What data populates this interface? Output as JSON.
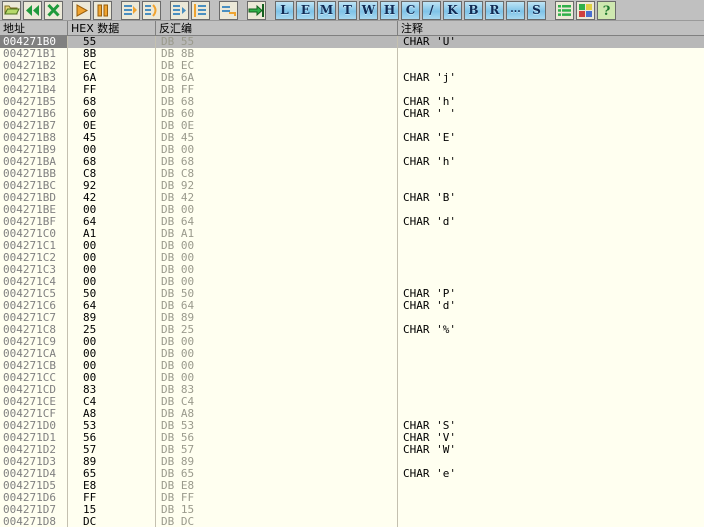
{
  "toolbar": {
    "buttons": [
      {
        "name": "open-file-icon",
        "kind": "icon",
        "icon": "folder"
      },
      {
        "name": "rewind-icon",
        "kind": "icon",
        "icon": "rewind"
      },
      {
        "name": "stop-icon",
        "kind": "icon",
        "icon": "stop-x"
      },
      {
        "name": "separator-1",
        "kind": "sep"
      },
      {
        "name": "run-icon",
        "kind": "icon",
        "icon": "play"
      },
      {
        "name": "pause-icon",
        "kind": "icon",
        "icon": "pause"
      },
      {
        "name": "separator-2",
        "kind": "sep"
      },
      {
        "name": "step-into-icon",
        "kind": "icon",
        "icon": "step-into"
      },
      {
        "name": "step-over-icon",
        "kind": "icon",
        "icon": "step-over"
      },
      {
        "name": "separator-3",
        "kind": "sep"
      },
      {
        "name": "trace-into-icon",
        "kind": "icon",
        "icon": "trace-into"
      },
      {
        "name": "trace-over-icon",
        "kind": "icon",
        "icon": "trace-over"
      },
      {
        "name": "separator-4",
        "kind": "sep"
      },
      {
        "name": "execute-till-return-icon",
        "kind": "icon",
        "icon": "till-return"
      },
      {
        "name": "separator-5",
        "kind": "sep"
      },
      {
        "name": "goto-icon",
        "kind": "icon",
        "icon": "goto-green"
      },
      {
        "name": "separator-6",
        "kind": "sep"
      },
      {
        "name": "log-window-button",
        "kind": "letter",
        "label": "L"
      },
      {
        "name": "executable-modules-button",
        "kind": "letter",
        "label": "E"
      },
      {
        "name": "memory-map-button",
        "kind": "letter",
        "label": "M"
      },
      {
        "name": "threads-button",
        "kind": "letter",
        "label": "T"
      },
      {
        "name": "windows-button",
        "kind": "letter",
        "label": "W"
      },
      {
        "name": "handles-button",
        "kind": "letter",
        "label": "H"
      },
      {
        "name": "cpu-button",
        "kind": "letter",
        "label": "C"
      },
      {
        "name": "patches-button",
        "kind": "letter",
        "label": "/"
      },
      {
        "name": "call-stack-button",
        "kind": "letter",
        "label": "K"
      },
      {
        "name": "breakpoints-button",
        "kind": "letter",
        "label": "B"
      },
      {
        "name": "references-button",
        "kind": "letter",
        "label": "R"
      },
      {
        "name": "run-trace-button",
        "kind": "letter",
        "label": "..."
      },
      {
        "name": "source-button",
        "kind": "letter",
        "label": "S"
      },
      {
        "name": "separator-7",
        "kind": "sep"
      },
      {
        "name": "options-list-icon",
        "kind": "icon",
        "icon": "list-green"
      },
      {
        "name": "appearance-icon",
        "kind": "icon",
        "icon": "palette"
      },
      {
        "name": "help-icon",
        "kind": "icon",
        "icon": "help"
      }
    ]
  },
  "grid": {
    "columns": [
      {
        "key": "address",
        "label": "地址"
      },
      {
        "key": "hex",
        "label": "HEX 数据"
      },
      {
        "key": "disasm",
        "label": "反汇编"
      },
      {
        "key": "comment",
        "label": "注释"
      }
    ],
    "selected_index": 0,
    "rows": [
      {
        "address": "004271B0",
        "hex": "55",
        "disasm": "DB  55",
        "comment": "CHAR 'U'"
      },
      {
        "address": "004271B1",
        "hex": "8B",
        "disasm": "DB  8B",
        "comment": ""
      },
      {
        "address": "004271B2",
        "hex": "EC",
        "disasm": "DB  EC",
        "comment": ""
      },
      {
        "address": "004271B3",
        "hex": "6A",
        "disasm": "DB  6A",
        "comment": "CHAR 'j'"
      },
      {
        "address": "004271B4",
        "hex": "FF",
        "disasm": "DB  FF",
        "comment": ""
      },
      {
        "address": "004271B5",
        "hex": "68",
        "disasm": "DB  68",
        "comment": "CHAR 'h'"
      },
      {
        "address": "004271B6",
        "hex": "60",
        "disasm": "DB  60",
        "comment": "CHAR ' '"
      },
      {
        "address": "004271B7",
        "hex": "0E",
        "disasm": "DB  0E",
        "comment": ""
      },
      {
        "address": "004271B8",
        "hex": "45",
        "disasm": "DB  45",
        "comment": "CHAR 'E'"
      },
      {
        "address": "004271B9",
        "hex": "00",
        "disasm": "DB  00",
        "comment": ""
      },
      {
        "address": "004271BA",
        "hex": "68",
        "disasm": "DB  68",
        "comment": "CHAR 'h'"
      },
      {
        "address": "004271BB",
        "hex": "C8",
        "disasm": "DB  C8",
        "comment": ""
      },
      {
        "address": "004271BC",
        "hex": "92",
        "disasm": "DB  92",
        "comment": ""
      },
      {
        "address": "004271BD",
        "hex": "42",
        "disasm": "DB  42",
        "comment": "CHAR 'B'"
      },
      {
        "address": "004271BE",
        "hex": "00",
        "disasm": "DB  00",
        "comment": ""
      },
      {
        "address": "004271BF",
        "hex": "64",
        "disasm": "DB  64",
        "comment": "CHAR 'd'"
      },
      {
        "address": "004271C0",
        "hex": "A1",
        "disasm": "DB  A1",
        "comment": ""
      },
      {
        "address": "004271C1",
        "hex": "00",
        "disasm": "DB  00",
        "comment": ""
      },
      {
        "address": "004271C2",
        "hex": "00",
        "disasm": "DB  00",
        "comment": ""
      },
      {
        "address": "004271C3",
        "hex": "00",
        "disasm": "DB  00",
        "comment": ""
      },
      {
        "address": "004271C4",
        "hex": "00",
        "disasm": "DB  00",
        "comment": ""
      },
      {
        "address": "004271C5",
        "hex": "50",
        "disasm": "DB  50",
        "comment": "CHAR 'P'"
      },
      {
        "address": "004271C6",
        "hex": "64",
        "disasm": "DB  64",
        "comment": "CHAR 'd'"
      },
      {
        "address": "004271C7",
        "hex": "89",
        "disasm": "DB  89",
        "comment": ""
      },
      {
        "address": "004271C8",
        "hex": "25",
        "disasm": "DB  25",
        "comment": "CHAR '%'"
      },
      {
        "address": "004271C9",
        "hex": "00",
        "disasm": "DB  00",
        "comment": ""
      },
      {
        "address": "004271CA",
        "hex": "00",
        "disasm": "DB  00",
        "comment": ""
      },
      {
        "address": "004271CB",
        "hex": "00",
        "disasm": "DB  00",
        "comment": ""
      },
      {
        "address": "004271CC",
        "hex": "00",
        "disasm": "DB  00",
        "comment": ""
      },
      {
        "address": "004271CD",
        "hex": "83",
        "disasm": "DB  83",
        "comment": ""
      },
      {
        "address": "004271CE",
        "hex": "C4",
        "disasm": "DB  C4",
        "comment": ""
      },
      {
        "address": "004271CF",
        "hex": "A8",
        "disasm": "DB  A8",
        "comment": ""
      },
      {
        "address": "004271D0",
        "hex": "53",
        "disasm": "DB  53",
        "comment": "CHAR 'S'"
      },
      {
        "address": "004271D1",
        "hex": "56",
        "disasm": "DB  56",
        "comment": "CHAR 'V'"
      },
      {
        "address": "004271D2",
        "hex": "57",
        "disasm": "DB  57",
        "comment": "CHAR 'W'"
      },
      {
        "address": "004271D3",
        "hex": "89",
        "disasm": "DB  89",
        "comment": ""
      },
      {
        "address": "004271D4",
        "hex": "65",
        "disasm": "DB  65",
        "comment": "CHAR 'e'"
      },
      {
        "address": "004271D5",
        "hex": "E8",
        "disasm": "DB  E8",
        "comment": ""
      },
      {
        "address": "004271D6",
        "hex": "FF",
        "disasm": "DB  FF",
        "comment": ""
      },
      {
        "address": "004271D7",
        "hex": "15",
        "disasm": "DB  15",
        "comment": ""
      },
      {
        "address": "004271D8",
        "hex": "DC",
        "disasm": "DB  DC",
        "comment": ""
      }
    ]
  }
}
